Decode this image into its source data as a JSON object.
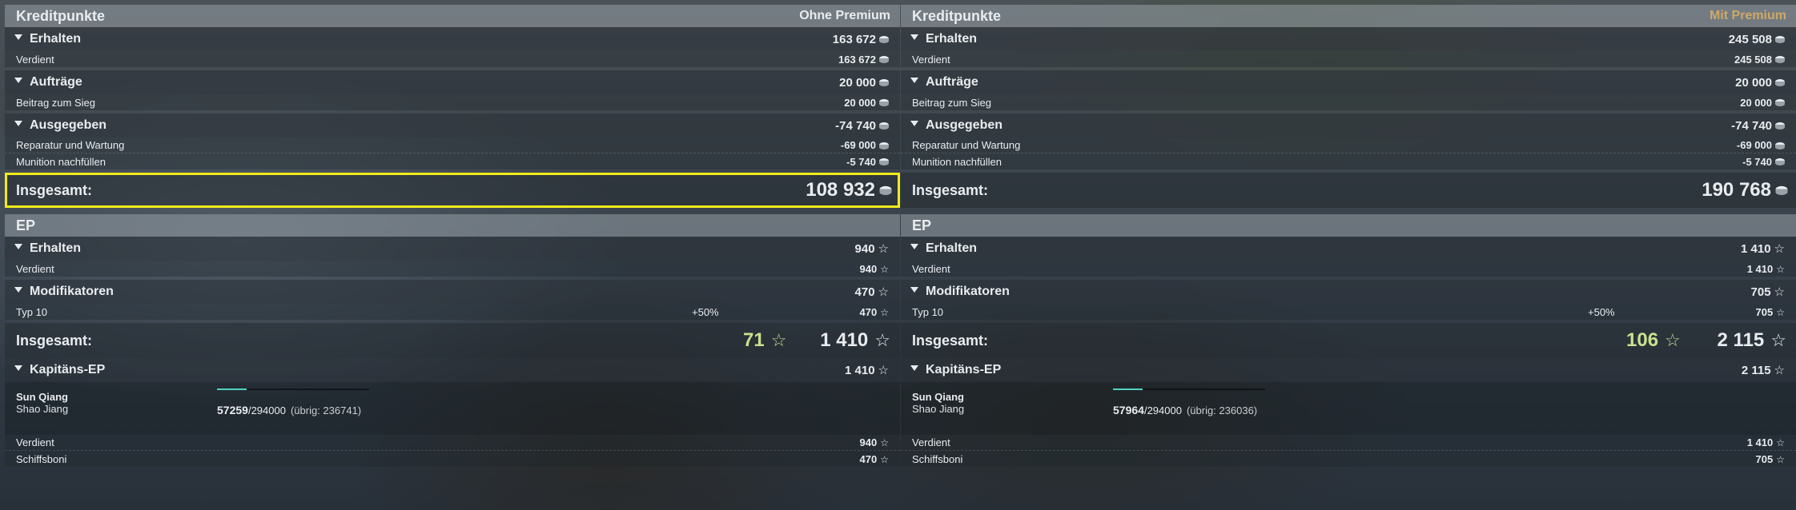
{
  "panels": [
    {
      "credits": {
        "title": "Kreditpunkte",
        "tag": "Ohne Premium",
        "earned": {
          "label": "Erhalten",
          "value": "163 672",
          "items": [
            {
              "label": "Verdient",
              "value": "163 672"
            }
          ]
        },
        "orders": {
          "label": "Aufträge",
          "value": "20 000",
          "items": [
            {
              "label": "Beitrag zum Sieg",
              "value": "20 000"
            }
          ]
        },
        "spent": {
          "label": "Ausgegeben",
          "value": "-74 740",
          "items": [
            {
              "label": "Reparatur und Wartung",
              "value": "-69 000"
            },
            {
              "label": "Munition nachfüllen",
              "value": "-5 740"
            }
          ]
        },
        "total": {
          "label": "Insgesamt:",
          "value": "108 932"
        }
      },
      "ep": {
        "title": "EP",
        "earned": {
          "label": "Erhalten",
          "value": "940",
          "items": [
            {
              "label": "Verdient",
              "value": "940"
            }
          ]
        },
        "modifiers": {
          "label": "Modifikatoren",
          "value": "470",
          "items": [
            {
              "label": "Typ 10",
              "percent": "+50%",
              "value": "470"
            }
          ]
        },
        "total": {
          "label": "Insgesamt:",
          "free_xp": "71",
          "value": "1 410"
        }
      },
      "captain": {
        "label": "Kapitäns-EP",
        "value": "1 410",
        "name": "Sun Qiang",
        "rank": "Shao Jiang",
        "xp_current": "57259",
        "xp_max": "294000",
        "xp_rest": "(übrig: 236741)",
        "progress": 0.195,
        "items": [
          {
            "label": "Verdient",
            "value": "940"
          },
          {
            "label": "Schiffsboni",
            "value": "470"
          }
        ]
      }
    },
    {
      "credits": {
        "title": "Kreditpunkte",
        "tag": "Mit Premium",
        "earned": {
          "label": "Erhalten",
          "value": "245 508",
          "items": [
            {
              "label": "Verdient",
              "value": "245 508"
            }
          ]
        },
        "orders": {
          "label": "Aufträge",
          "value": "20 000",
          "items": [
            {
              "label": "Beitrag zum Sieg",
              "value": "20 000"
            }
          ]
        },
        "spent": {
          "label": "Ausgegeben",
          "value": "-74 740",
          "items": [
            {
              "label": "Reparatur und Wartung",
              "value": "-69 000"
            },
            {
              "label": "Munition nachfüllen",
              "value": "-5 740"
            }
          ]
        },
        "total": {
          "label": "Insgesamt:",
          "value": "190 768"
        }
      },
      "ep": {
        "title": "EP",
        "earned": {
          "label": "Erhalten",
          "value": "1 410",
          "items": [
            {
              "label": "Verdient",
              "value": "1 410"
            }
          ]
        },
        "modifiers": {
          "label": "Modifikatoren",
          "value": "705",
          "items": [
            {
              "label": "Typ 10",
              "percent": "+50%",
              "value": "705"
            }
          ]
        },
        "total": {
          "label": "Insgesamt:",
          "free_xp": "106",
          "value": "2 115"
        }
      },
      "captain": {
        "label": "Kapitäns-EP",
        "value": "2 115",
        "name": "Sun Qiang",
        "rank": "Shao Jiang",
        "xp_current": "57964",
        "xp_max": "294000",
        "xp_rest": "(übrig: 236036)",
        "progress": 0.197,
        "items": [
          {
            "label": "Verdient",
            "value": "1 410"
          },
          {
            "label": "Schiffsboni",
            "value": "705"
          }
        ]
      }
    }
  ],
  "colors": {
    "highlight": "#f2ea1c",
    "premium_tag": "#cfa868",
    "free_xp": "#c9e08e",
    "progress": "#4fd3c4"
  },
  "icons": {
    "credit": "credit-coin-icon",
    "xp": "star-icon",
    "collapse": "triangle-down-icon"
  }
}
